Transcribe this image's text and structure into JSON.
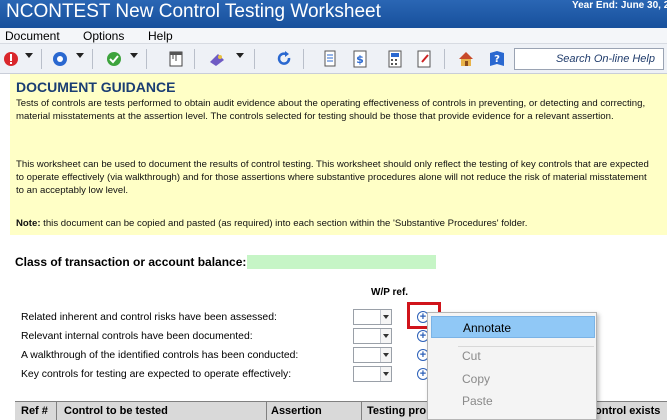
{
  "window": {
    "title": "NCONTEST New Control Testing Worksheet",
    "year_end": "Year End: June 30, 2"
  },
  "menu": {
    "items": [
      "Document",
      "Options",
      "Help"
    ]
  },
  "toolbar": {
    "icons": [
      "stop-icon",
      "navigate-icon",
      "check-icon",
      "ruler-icon",
      "tools-icon",
      "refresh-icon",
      "document-icon",
      "money-icon",
      "calculator-icon",
      "edit-icon",
      "home-icon",
      "help-icon"
    ],
    "search_placeholder": "Search On-line Help"
  },
  "guidance": {
    "heading": "DOCUMENT GUIDANCE",
    "para1": "Tests of controls are tests performed to obtain audit evidence about the operating effectiveness of controls in preventing, or detecting and correcting, material misstatements at the assertion level.  The controls selected for testing should be those that provide evidence for a relevant assertion.",
    "para2": "This worksheet can be used to document the results of control testing. This worksheet should only reflect the testing of key controls that are expected to operate effectively (via walkthrough) and for those assertions where substantive procedures alone will not reduce the risk of material misstatement to an acceptably low level.",
    "note_label": "Note:",
    "note_text": " this document can be copied and pasted (as required) into each section within the 'Substantive Procedures' folder."
  },
  "form": {
    "class_label": "Class of transaction or account balance:",
    "class_value": "",
    "wp_ref_header": "W/P ref.",
    "questions": [
      {
        "label": "Related inherent and control risks have been assessed:",
        "value": ""
      },
      {
        "label": "Relevant internal controls have been documented:",
        "value": ""
      },
      {
        "label": "A walkthrough of the identified controls has been conducted:",
        "value": ""
      },
      {
        "label": "Key controls for testing are expected to operate effectively:",
        "value": ""
      }
    ]
  },
  "table": {
    "headers": [
      "Ref #",
      "Control to be tested",
      "Assertion",
      "Testing pro",
      "ontrol exists"
    ]
  },
  "context_menu": {
    "items": [
      {
        "label": "Annotate",
        "state": "highlighted"
      },
      {
        "label": "Cut",
        "state": "disabled"
      },
      {
        "label": "Copy",
        "state": "disabled"
      },
      {
        "label": "Paste",
        "state": "disabled"
      }
    ]
  },
  "colors": {
    "titlebar": "#1f5aa8",
    "guidance_bg": "#ffffc6",
    "heading": "#1a3d73",
    "input_green": "#c6f5c6",
    "highlight_red": "#d0141b",
    "menu_hover": "#90c8f6"
  }
}
